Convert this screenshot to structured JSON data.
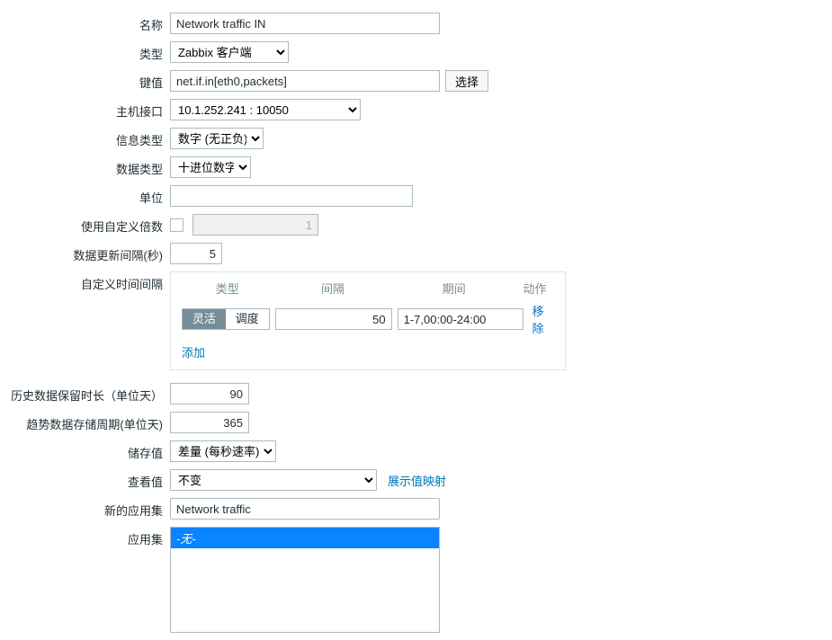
{
  "labels": {
    "name": "名称",
    "type": "类型",
    "key": "键值",
    "host_if": "主机接口",
    "info_type": "信息类型",
    "data_type": "数据类型",
    "units": "单位",
    "multiplier": "使用自定义倍数",
    "update_interval": "数据更新间隔(秒)",
    "custom_intervals": "自定义时间间隔",
    "history": "历史数据保留时长（单位天）",
    "trends": "趋势数据存储周期(单位天)",
    "store_value": "储存值",
    "show_value": "查看值",
    "new_app": "新的应用集",
    "applications": "应用集"
  },
  "values": {
    "name": "Network traffic IN",
    "type": "Zabbix 客户端",
    "key": "net.if.in[eth0,packets]",
    "host_if": "10.1.252.241 : 10050",
    "info_type": "数字 (无正负)",
    "data_type": "十进位数字",
    "units": "",
    "multiplier_disabled": "1",
    "update_interval": "5",
    "history": "90",
    "trends": "365",
    "store_value": "差量 (每秒速率)",
    "show_value": "不变",
    "new_app": "Network traffic",
    "app_none": "-无-"
  },
  "intervals": {
    "headers": {
      "type": "类型",
      "interval": "间隔",
      "period": "期间",
      "action": "动作"
    },
    "seg_flex": "灵活",
    "seg_sched": "调度",
    "row_interval": "50",
    "row_period": "1-7,00:00-24:00",
    "remove": "移除",
    "add": "添加"
  },
  "buttons": {
    "select": "选择",
    "show_map": "展示值映射"
  }
}
